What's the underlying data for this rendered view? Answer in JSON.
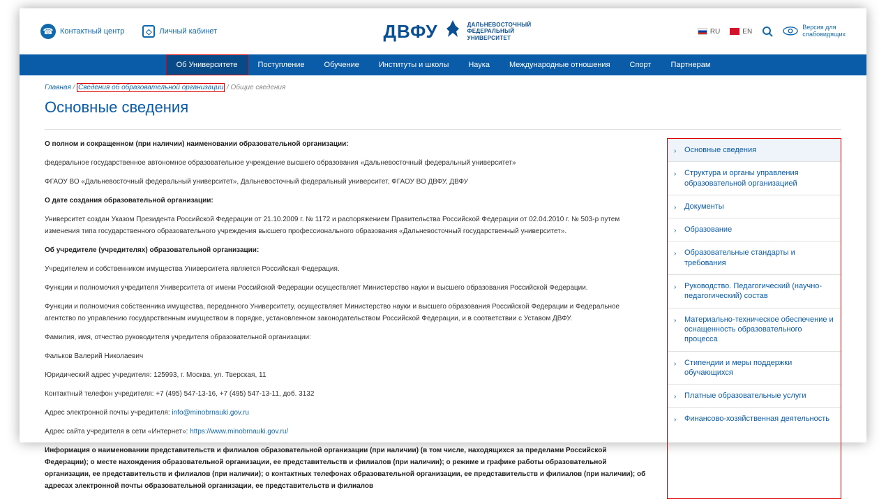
{
  "header": {
    "contact_center": "Контактный центр",
    "personal_cabinet": "Личный кабинет",
    "logo_main": "ДВФУ",
    "logo_sub_1": "ДАЛЬНЕВОСТОЧНЫЙ",
    "logo_sub_2": "ФЕДЕРАЛЬНЫЙ",
    "logo_sub_3": "УНИВЕРСИТЕТ",
    "lang_ru": "RU",
    "lang_en": "EN",
    "accessibility_1": "Версия для",
    "accessibility_2": "слабовидящих"
  },
  "nav": {
    "items": [
      "Об Университете",
      "Поступление",
      "Обучение",
      "Институты и школы",
      "Наука",
      "Международные отношения",
      "Спорт",
      "Партнерам"
    ]
  },
  "breadcrumb": {
    "home": "Главная",
    "mid": "Сведения об образовательной организации",
    "current": "Общие сведения"
  },
  "page_title": "Основные сведения",
  "content": {
    "h1": "О полном и сокращенном (при наличии) наименовании образовательной организации:",
    "p1": "федеральное государственное автономное образовательное учреждение высшего образования «Дальневосточный федеральный университет»",
    "p2": "ФГАОУ ВО «Дальневосточный федеральный университет», Дальневосточный федеральный университет, ФГАОУ ВО ДВФУ, ДВФУ",
    "h2": "О дате создания образовательной организации:",
    "p3": "Университет создан Указом Президента Российской Федерации от 21.10.2009 г. № 1172 и распоряжением Правительства Российской Федерации от 02.04.2010 г. № 503-р путем изменения типа государственного образовательного учреждения высшего профессионального образования «Дальневосточный государственный университет».",
    "h3": "Об учредителе (учредителях) образовательной организации:",
    "p4": "Учредителем и собственником имущества Университета является Российская Федерация.",
    "p5": "Функции и полномочия учредителя Университета от имени Российской Федерации осуществляет Министерство науки и высшего образования Российской Федерации.",
    "p6": "Функции и полномочия собственника имущества, переданного Университету, осуществляет Министерство науки и высшего образования Российской Федерации и Федеральное агентство по управлению государственным имуществом в порядке, установленном законодательством Российской Федерации, и в соответствии с Уставом ДВФУ.",
    "p7": "Фамилия, имя, отчество руководителя учредителя образовательной организации:",
    "p8": "Фальков Валерий Николаевич",
    "p9": "Юридический адрес учредителя: 125993, г. Москва, ул. Тверская, 11",
    "p10": "Контактный телефон учредителя: +7 (495) 547-13-16, +7 (495) 547-13-11, доб. 3132",
    "p11_pre": "Адрес электронной почты учредителя: ",
    "p11_link": "info@minobrnauki.gov.ru",
    "p12_pre": "Адрес сайта учредителя в сети «Интернет»: ",
    "p12_link": "https://www.minobrnauki.gov.ru/",
    "h4": "Информация о наименовании представительств и филиалов образовательной организации (при наличии) (в том числе, находящихся за пределами Российской Федерации); о месте нахождения образовательной организации, ее представительств и филиалов (при наличии); о режиме и графике работы образовательной организации, ее представительств и филиалов (при наличии); о контактных телефонах образовательной организации, ее представительств и филиалов (при наличии); об адресах электронной почты образовательной организации, ее представительств и филиалов"
  },
  "sidebar": {
    "items": [
      "Основные сведения",
      "Структура и органы управления образовательной организацией",
      "Документы",
      "Образование",
      "Образовательные стандарты и требования",
      "Руководство. Педагогический (научно-педагогический) состав",
      "Материально-техническое обеспечение и оснащенность образовательного процесса",
      "Стипендии и меры поддержки обучающихся",
      "Платные образовательные услуги",
      "Финансово-хозяйственная деятельность"
    ]
  }
}
